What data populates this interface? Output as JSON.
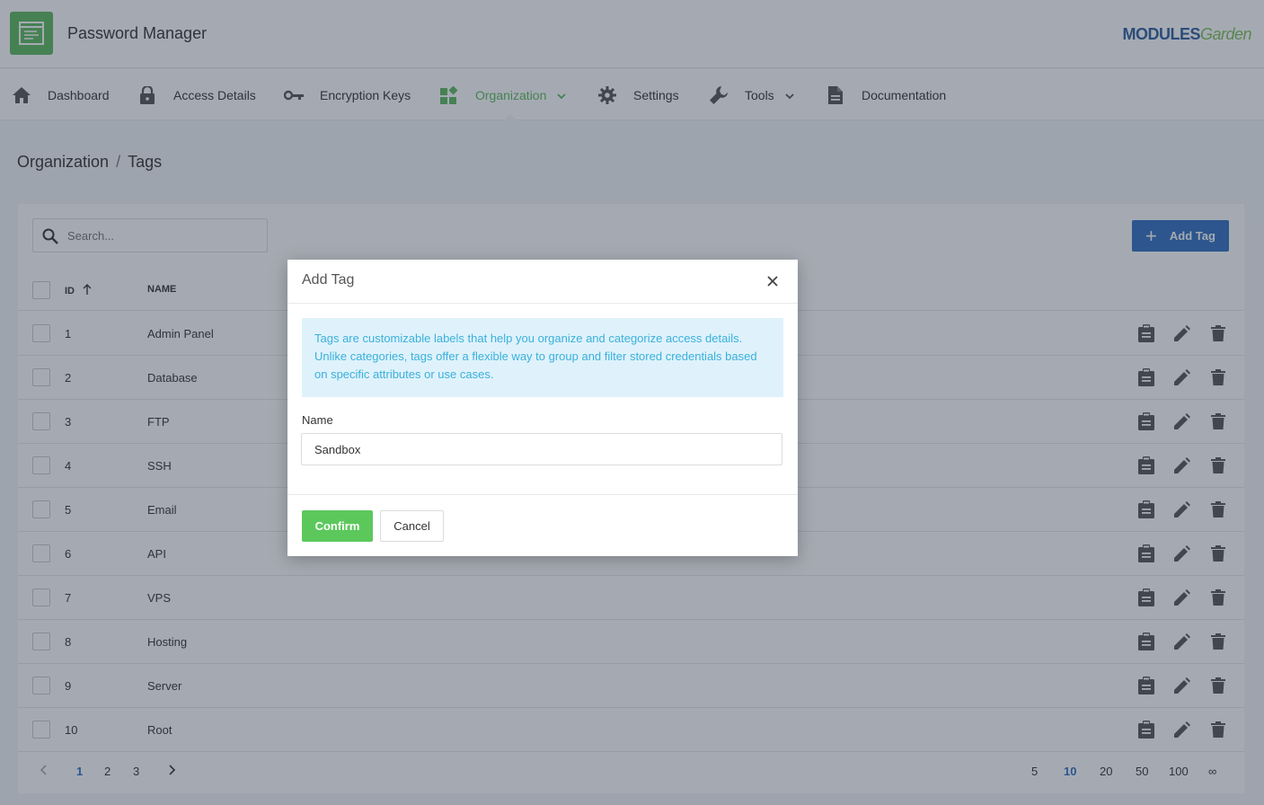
{
  "app": {
    "title": "Password Manager",
    "brand_main": "MODULES",
    "brand_accent": "Garden"
  },
  "nav": {
    "items": [
      {
        "label": "Dashboard",
        "icon": "home-icon"
      },
      {
        "label": "Access Details",
        "icon": "lock-icon"
      },
      {
        "label": "Encryption Keys",
        "icon": "key-icon"
      },
      {
        "label": "Organization",
        "icon": "widgets-icon",
        "active": true,
        "dropdown": true
      },
      {
        "label": "Settings",
        "icon": "gear-icon"
      },
      {
        "label": "Tools",
        "icon": "wrench-icon",
        "dropdown": true
      },
      {
        "label": "Documentation",
        "icon": "document-icon"
      }
    ]
  },
  "breadcrumb": {
    "parent": "Organization",
    "separator": "/",
    "current": "Tags"
  },
  "toolbar": {
    "search_placeholder": "Search...",
    "add_label": "Add Tag"
  },
  "table": {
    "columns": {
      "id": "ID",
      "name": "NAME"
    },
    "rows": [
      {
        "id": "1",
        "name": "Admin Panel"
      },
      {
        "id": "2",
        "name": "Database"
      },
      {
        "id": "3",
        "name": "FTP"
      },
      {
        "id": "4",
        "name": "SSH"
      },
      {
        "id": "5",
        "name": "Email"
      },
      {
        "id": "6",
        "name": "API"
      },
      {
        "id": "7",
        "name": "VPS"
      },
      {
        "id": "8",
        "name": "Hosting"
      },
      {
        "id": "9",
        "name": "Server"
      },
      {
        "id": "10",
        "name": "Root"
      }
    ]
  },
  "pagination": {
    "pages": [
      "1",
      "2",
      "3"
    ],
    "current_page": "1",
    "page_sizes": [
      "5",
      "10",
      "20",
      "50",
      "100",
      "∞"
    ],
    "current_size": "10"
  },
  "modal": {
    "title": "Add Tag",
    "info": "Tags are customizable labels that help you organize and categorize access details. Unlike categories, tags offer a flexible way to group and filter stored credentials based on specific attributes or use cases.",
    "name_label": "Name",
    "name_value": "Sandbox",
    "confirm_label": "Confirm",
    "cancel_label": "Cancel"
  },
  "colors": {
    "accent_green": "#5cb85c",
    "primary_blue": "#2f6fc0",
    "info_bg": "#dff2fb",
    "info_text": "#3ab0dc"
  }
}
